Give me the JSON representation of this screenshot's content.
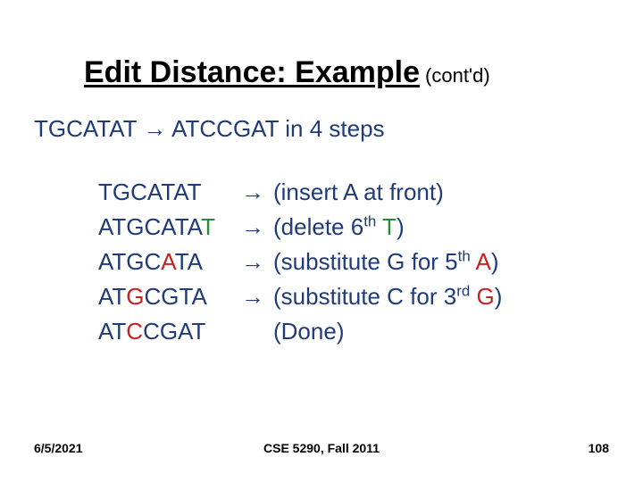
{
  "title": {
    "main": "Edit Distance: Example",
    "cont": "(cont'd)"
  },
  "intro": {
    "from": "TGCATAT",
    "arrow": "→",
    "to": "ATCCGAT",
    "tail": "in 4 steps"
  },
  "steps": [
    {
      "seq": [
        {
          "t": "TGCATAT",
          "c": ""
        }
      ],
      "arrow": "→",
      "desc": [
        {
          "t": "(insert A at front)",
          "c": ""
        }
      ]
    },
    {
      "seq": [
        {
          "t": "ATGCATA",
          "c": ""
        },
        {
          "t": "T",
          "c": "hl-grn"
        }
      ],
      "arrow": "→",
      "desc": [
        {
          "t": "(delete 6",
          "c": ""
        },
        {
          "t": "th",
          "c": "sup"
        },
        {
          "t": " ",
          "c": ""
        },
        {
          "t": "T",
          "c": "hl-grn"
        },
        {
          "t": ")",
          "c": ""
        }
      ]
    },
    {
      "seq": [
        {
          "t": "ATGC",
          "c": ""
        },
        {
          "t": "A",
          "c": "hl-red"
        },
        {
          "t": "TA",
          "c": ""
        }
      ],
      "arrow": "→",
      "desc": [
        {
          "t": "(substitute G for 5",
          "c": ""
        },
        {
          "t": "th",
          "c": "sup"
        },
        {
          "t": " ",
          "c": ""
        },
        {
          "t": "A",
          "c": "hl-red"
        },
        {
          "t": ")",
          "c": ""
        }
      ]
    },
    {
      "seq": [
        {
          "t": "AT",
          "c": ""
        },
        {
          "t": "G",
          "c": "hl-red"
        },
        {
          "t": "CGTA",
          "c": ""
        }
      ],
      "arrow": "→",
      "desc": [
        {
          "t": "(substitute C for 3",
          "c": ""
        },
        {
          "t": "rd",
          "c": "sup"
        },
        {
          "t": " ",
          "c": ""
        },
        {
          "t": "G",
          "c": "hl-red"
        },
        {
          "t": ")",
          "c": ""
        }
      ]
    },
    {
      "seq": [
        {
          "t": "AT",
          "c": ""
        },
        {
          "t": "C",
          "c": "hl-red"
        },
        {
          "t": "CGAT",
          "c": ""
        }
      ],
      "arrow": "",
      "desc": [
        {
          "t": "(Done)",
          "c": ""
        }
      ]
    }
  ],
  "footer": {
    "date": "6/5/2021",
    "course": "CSE 5290, Fall 2011",
    "page": "108"
  }
}
